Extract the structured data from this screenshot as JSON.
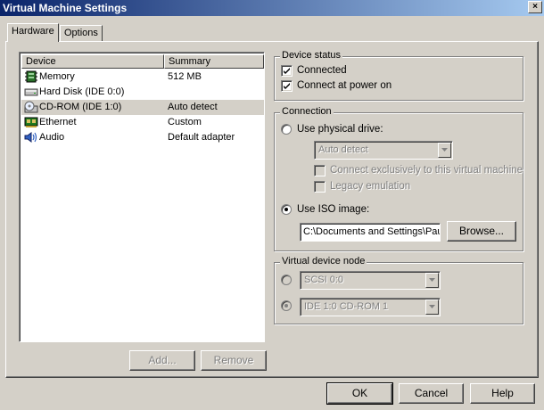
{
  "window": {
    "title": "Virtual Machine Settings",
    "close_label": "×",
    "title_gradient": [
      "#0a246a",
      "#a6caf0"
    ]
  },
  "tabs": [
    {
      "label": "Hardware",
      "active": true
    },
    {
      "label": "Options",
      "active": false
    }
  ],
  "device_list": {
    "columns": [
      "Device",
      "Summary"
    ],
    "rows": [
      {
        "device": "Memory",
        "summary": "512 MB",
        "icon": "memory-icon"
      },
      {
        "device": "Hard Disk (IDE 0:0)",
        "summary": "",
        "icon": "hard-disk-icon"
      },
      {
        "device": "CD-ROM (IDE 1:0)",
        "summary": "Auto detect",
        "icon": "cdrom-icon",
        "selected": true
      },
      {
        "device": "Ethernet",
        "summary": "Custom",
        "icon": "ethernet-icon"
      },
      {
        "device": "Audio",
        "summary": "Default adapter",
        "icon": "audio-icon"
      }
    ]
  },
  "list_buttons": {
    "add": "Add...",
    "remove": "Remove"
  },
  "device_status": {
    "title": "Device status",
    "connected": {
      "label": "Connected",
      "checked": true
    },
    "connect_at_power_on": {
      "label": "Connect at power on",
      "checked": true
    }
  },
  "connection": {
    "title": "Connection",
    "physical_drive": {
      "label": "Use physical drive:",
      "selected": false,
      "drive_value": "Auto detect",
      "exclusive": {
        "label": "Connect exclusively to this virtual machine",
        "checked": false
      },
      "legacy": {
        "label": "Legacy emulation",
        "checked": false
      }
    },
    "iso_image": {
      "label": "Use ISO image:",
      "selected": true,
      "path": "C:\\Documents and Settings\\Pau",
      "browse_label": "Browse..."
    }
  },
  "virtual_device_node": {
    "title": "Virtual device node",
    "scsi": {
      "value": "SCSI 0:0",
      "selected": false
    },
    "ide": {
      "value": "IDE 1:0  CD-ROM 1",
      "selected": true
    }
  },
  "footer": {
    "ok": "OK",
    "cancel": "Cancel",
    "help": "Help"
  }
}
